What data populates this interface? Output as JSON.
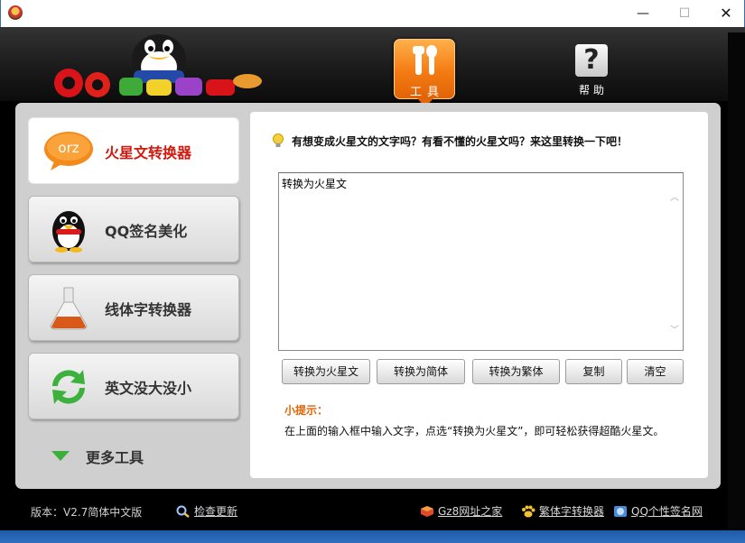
{
  "window": {
    "minimize": "—",
    "maximize": "☐",
    "close": "✕"
  },
  "header": {
    "tools_label": "工具",
    "help_label": "帮助",
    "help_symbol": "?"
  },
  "sidebar": {
    "items": [
      {
        "label": "火星文转换器",
        "icon": "orz-bubble-icon",
        "active": true
      },
      {
        "label": "QQ签名美化",
        "icon": "qq-penguin-icon",
        "active": false
      },
      {
        "label": "线体字转换器",
        "icon": "flask-icon",
        "active": false
      },
      {
        "label": "英文没大没小",
        "icon": "refresh-arrows-icon",
        "active": false
      }
    ],
    "more_label": "更多工具",
    "orz_text": "orz"
  },
  "main": {
    "prompt": "有想变成火星文的文字吗？有看不懂的火星文吗？来这里转换一下吧！",
    "input_value": "转换为火星文",
    "buttons": {
      "to_martian": "转换为火星文",
      "to_simplified": "转换为简体",
      "to_traditional": "转换为繁体",
      "copy": "复制",
      "clear": "清空"
    },
    "tip_title": "小提示：",
    "tip_body": "在上面的输入框中输入文字，点选“转换为火星文”，即可轻松获得超酷火星文。"
  },
  "footer": {
    "version": "版本：V2.7简体中文版",
    "check_update": "检查更新",
    "links": [
      "Gz8网址之家",
      "繁体字转换器",
      "QQ个性签名网"
    ]
  },
  "colors": {
    "accent_orange": "#f47b12",
    "active_red": "#d01a10",
    "tip_orange": "#e06408"
  }
}
